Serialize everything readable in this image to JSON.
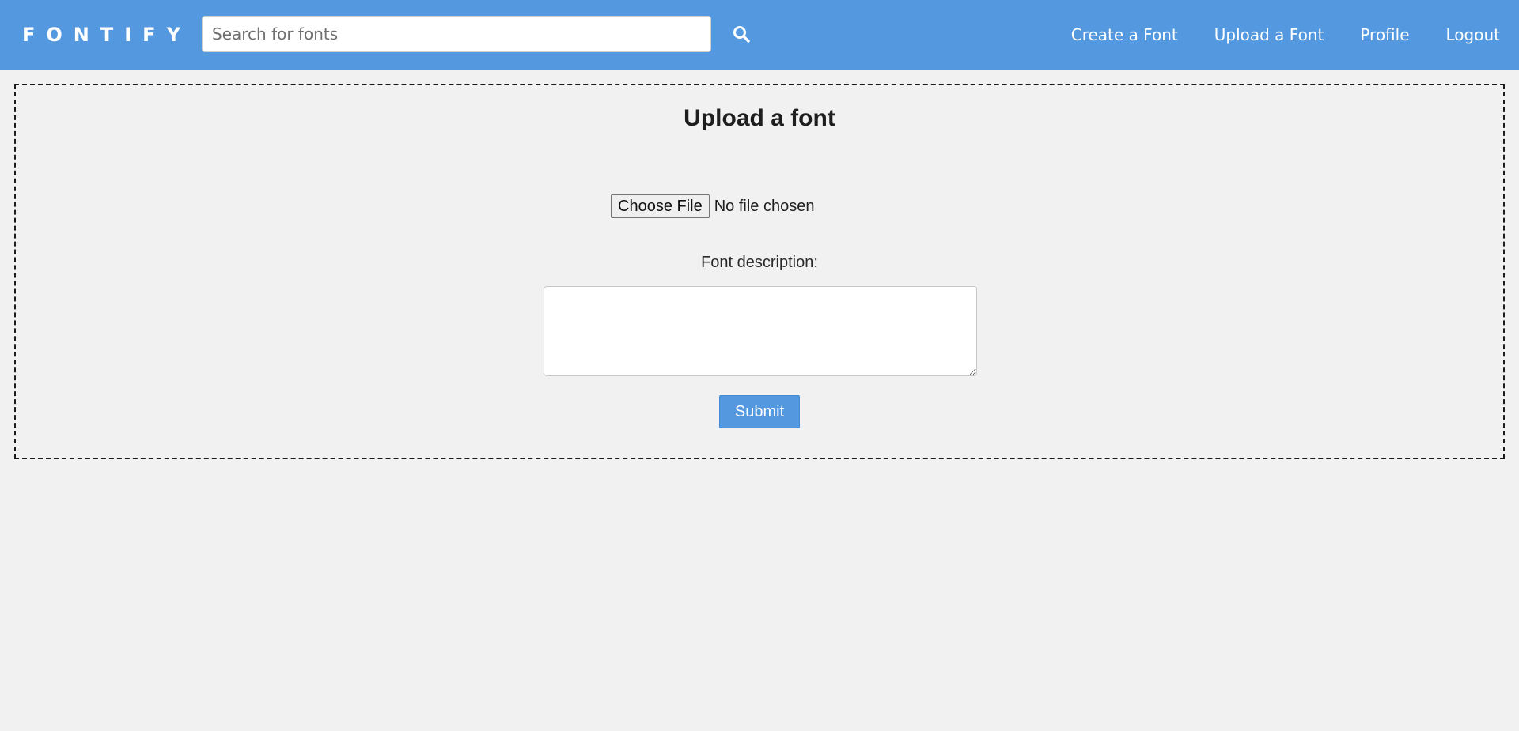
{
  "app": {
    "logo_text": "FONTIFY",
    "accent_color": "#5499e0"
  },
  "header": {
    "search": {
      "placeholder": "Search for fonts",
      "value": "",
      "icon": "search-icon"
    },
    "nav": {
      "create_font": "Create a Font",
      "upload_font": "Upload a Font",
      "profile": "Profile",
      "logout": "Logout"
    }
  },
  "main": {
    "title": "Upload a font",
    "file_input": {
      "button_label": "Choose File",
      "status": "No file chosen"
    },
    "description": {
      "label": "Font description:",
      "value": ""
    },
    "submit_label": "Submit"
  }
}
